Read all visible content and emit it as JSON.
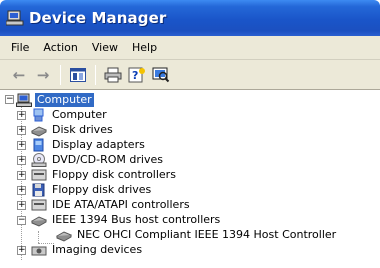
{
  "window": {
    "title": "Device Manager"
  },
  "menu": [
    "File",
    "Action",
    "View",
    "Help"
  ],
  "toolbar": {
    "buttons": [
      "back-arrow-icon",
      "forward-arrow-icon",
      "properties-pane-icon",
      "print-icon",
      "help-icon",
      "scan-hardware-icon"
    ]
  },
  "tree": {
    "root": {
      "label": "Computer"
    },
    "items": [
      {
        "label": "Computer",
        "icon": "computer-icon",
        "expander": "+"
      },
      {
        "label": "Disk drives",
        "icon": "disk-drive-icon",
        "expander": "+"
      },
      {
        "label": "Display adapters",
        "icon": "display-adapter-icon",
        "expander": "+"
      },
      {
        "label": "DVD/CD-ROM drives",
        "icon": "cdrom-icon",
        "expander": "+"
      },
      {
        "label": "Floppy disk controllers",
        "icon": "floppy-controller-icon",
        "expander": "+"
      },
      {
        "label": "Floppy disk drives",
        "icon": "floppy-drive-icon",
        "expander": "+"
      },
      {
        "label": "IDE ATA/ATAPI controllers",
        "icon": "ide-controller-icon",
        "expander": "+"
      },
      {
        "label": "IEEE 1394 Bus host controllers",
        "icon": "ieee1394-icon",
        "expander": "−"
      },
      {
        "label": "NEC OHCI Compliant IEEE 1394 Host Controller",
        "icon": "ieee1394-device-icon",
        "expander": ""
      },
      {
        "label": "Imaging devices",
        "icon": "imaging-icon",
        "expander": "+"
      }
    ]
  },
  "colors": {
    "titlebar": "#1b50c0",
    "selection": "#316ac5",
    "chrome": "#ece9d8"
  }
}
